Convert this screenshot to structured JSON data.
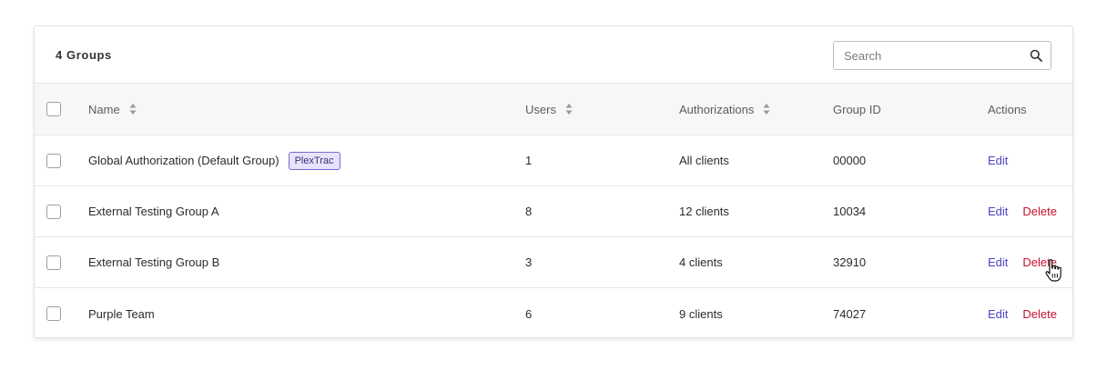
{
  "header": {
    "group_count": "4 Groups",
    "search": {
      "placeholder": "Search",
      "value": ""
    }
  },
  "columns": {
    "name": "Name",
    "users": "Users",
    "authorizations": "Authorizations",
    "group_id": "Group ID",
    "actions": "Actions"
  },
  "rows": [
    {
      "name": "Global Authorization (Default Group)",
      "badge": "PlexTrac",
      "users": "1",
      "authorizations": "All clients",
      "group_id": "00000",
      "edit": "Edit",
      "delete": ""
    },
    {
      "name": "External Testing Group A",
      "users": "8",
      "authorizations": "12 clients",
      "group_id": "10034",
      "edit": "Edit",
      "delete": "Delete"
    },
    {
      "name": "External Testing Group B",
      "users": "3",
      "authorizations": "4 clients",
      "group_id": "32910",
      "edit": "Edit",
      "delete": "Delete"
    },
    {
      "name": "Purple Team",
      "users": "6",
      "authorizations": "9 clients",
      "group_id": "74027",
      "edit": "Edit",
      "delete": "Delete"
    }
  ],
  "colors": {
    "edit_link": "#4b43c7",
    "delete_link": "#c8102e",
    "badge_bg": "#e8e3fb",
    "badge_border": "#7a6bd0"
  },
  "icons": {
    "search": "search-icon",
    "sort": "sort-icon",
    "cursor": "hand-pointer-cursor-icon"
  }
}
